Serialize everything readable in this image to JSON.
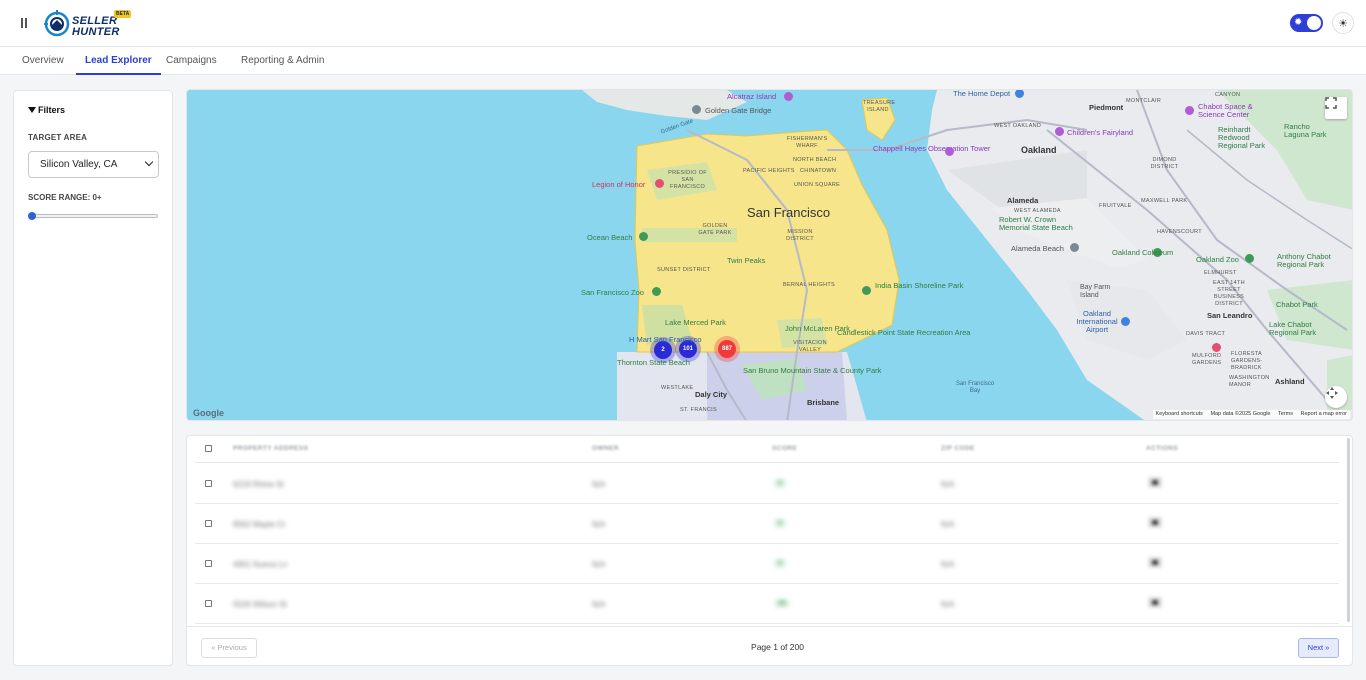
{
  "header": {
    "logo": {
      "line1": "SELLER",
      "line2": "HUNTER",
      "badge": "BETA"
    },
    "theme_toggle": {
      "state": "on"
    }
  },
  "tabs": [
    {
      "label": "Overview",
      "active": false
    },
    {
      "label": "Lead Explorer",
      "active": true
    },
    {
      "label": "Campaigns",
      "active": false
    },
    {
      "label": "Reporting & Admin",
      "active": false
    }
  ],
  "filters": {
    "title": "Filters",
    "target_area_label": "TARGET AREA",
    "target_area_value": "Silicon Valley, CA",
    "score_range_label": "SCORE RANGE: 0+",
    "score_min": 0
  },
  "map": {
    "cities": {
      "san_francisco": "San Francisco",
      "oakland": "Oakland",
      "alameda": "Alameda",
      "daly_city": "Daly City",
      "brisbane": "Brisbane",
      "piedmont": "Piedmont",
      "san_leandro": "San Leandro",
      "ashland": "Ashland"
    },
    "pois": {
      "alcatraz": "Alcatraz Island",
      "golden_gate_bridge": "Golden Gate Bridge",
      "legion_of_honor": "Legion of Honor",
      "ocean_beach": "Ocean Beach",
      "sf_zoo": "San Francisco Zoo",
      "lake_merced": "Lake Merced Park",
      "thornton": "Thornton State Beach",
      "twin_peaks": "Twin Peaks",
      "mclaren": "John McLaren Park",
      "candlestick": "Candlestick Point State Recreation Area",
      "india_basin": "India Basin Shoreline Park",
      "san_bruno_mtn": "San Bruno Mountain State & County Park",
      "chappell": "Chappell Hayes Observation Tower",
      "home_depot": "The Home Depot",
      "childrens_fairyland": "Children's Fairyland",
      "chabot_space": "Chabot Space & Science Center",
      "reinhardt": "Reinhardt Redwood Regional Park",
      "rancho_laguna": "Rancho Laguna Park",
      "crown_beach": "Robert W. Crown Memorial State Beach",
      "alameda_beach": "Alameda Beach",
      "oakland_coliseum": "Oakland Coliseum",
      "oakland_zoo": "Oakland Zoo",
      "anthony_chabot": "Anthony Chabot Regional Park",
      "chabot_park": "Chabot Park",
      "lake_chabot": "Lake Chabot Regional Park",
      "oakland_airport": "Oakland International Airport",
      "bay_farm": "Bay Farm Island",
      "treasure_island": "TREASURE ISLAND",
      "hmart": "H Mart San Francisco"
    },
    "neighborhoods": {
      "presidio": "PRESIDIO OF SAN FRANCISCO",
      "fisherman": "FISHERMAN'S WHARF",
      "north_beach": "NORTH BEACH",
      "chinatown": "CHINATOWN",
      "pacific_heights": "PACIFIC HEIGHTS",
      "union_square": "UNION SQUARE",
      "golden_gate_park": "GOLDEN GATE PARK",
      "mission": "MISSION DISTRICT",
      "sunset": "SUNSET DISTRICT",
      "bernal": "BERNAL HEIGHTS",
      "visitacion": "VISITACION VALLEY",
      "westlake": "WESTLAKE",
      "st_francis": "ST. FRANCIS",
      "west_oakland": "WEST OAKLAND",
      "dimond": "DIMOND DISTRICT",
      "fruitvale": "FRUITVALE",
      "west_alameda": "WEST ALAMEDA",
      "maxwell_park": "MAXWELL PARK",
      "havenscourt": "HAVENSCOURT",
      "canyon": "CANYON",
      "montclair": "MONTCLAIR",
      "elmhurst": "ELMHURST",
      "east_14th": "EAST 14TH STREET BUSINESS DISTRICT",
      "davis_tract": "DAVIS TRACT",
      "mulford": "MULFORD GARDENS",
      "floresta": "FLORESTA GARDENS-BRADRICK",
      "washington_manor": "WASHINGTON MANOR",
      "golden_gate_label": "Golden Gate",
      "sf_bay": "San Francisco Bay"
    },
    "clusters": [
      {
        "label": "2",
        "color": "#2a2ad6"
      },
      {
        "label": "101",
        "color": "#2a2ad6"
      },
      {
        "label": "887",
        "color": "#f03a3a"
      }
    ],
    "google": "Google",
    "attribution": {
      "shortcuts": "Keyboard shortcuts",
      "data": "Map data ©2025 Google",
      "terms": "Terms",
      "report": "Report a map error"
    },
    "colors": {
      "water": "#8ad6ee",
      "land": "#eaecee",
      "highlight": "#f6e58a",
      "park": "#bfe3c4"
    }
  },
  "table": {
    "columns": [
      "PROPERTY ADDRESS",
      "OWNER",
      "SCORE",
      "ZIP CODE",
      "ACTIONS"
    ],
    "rows": [
      {
        "address": "6219 Rhine St",
        "owner": "N/A",
        "score": "0",
        "zip": "N/A"
      },
      {
        "address": "8562 Maple Ct",
        "owner": "N/A",
        "score": "0",
        "zip": "N/A"
      },
      {
        "address": "4901 Nueva Ln",
        "owner": "N/A",
        "score": "0",
        "zip": "N/A"
      },
      {
        "address": "5526 Wilson St",
        "owner": "N/A",
        "score": "36",
        "zip": "N/A"
      }
    ]
  },
  "pagination": {
    "prev_label": "« Previous",
    "page_info": "Page 1 of 200",
    "next_label": "Next »"
  }
}
